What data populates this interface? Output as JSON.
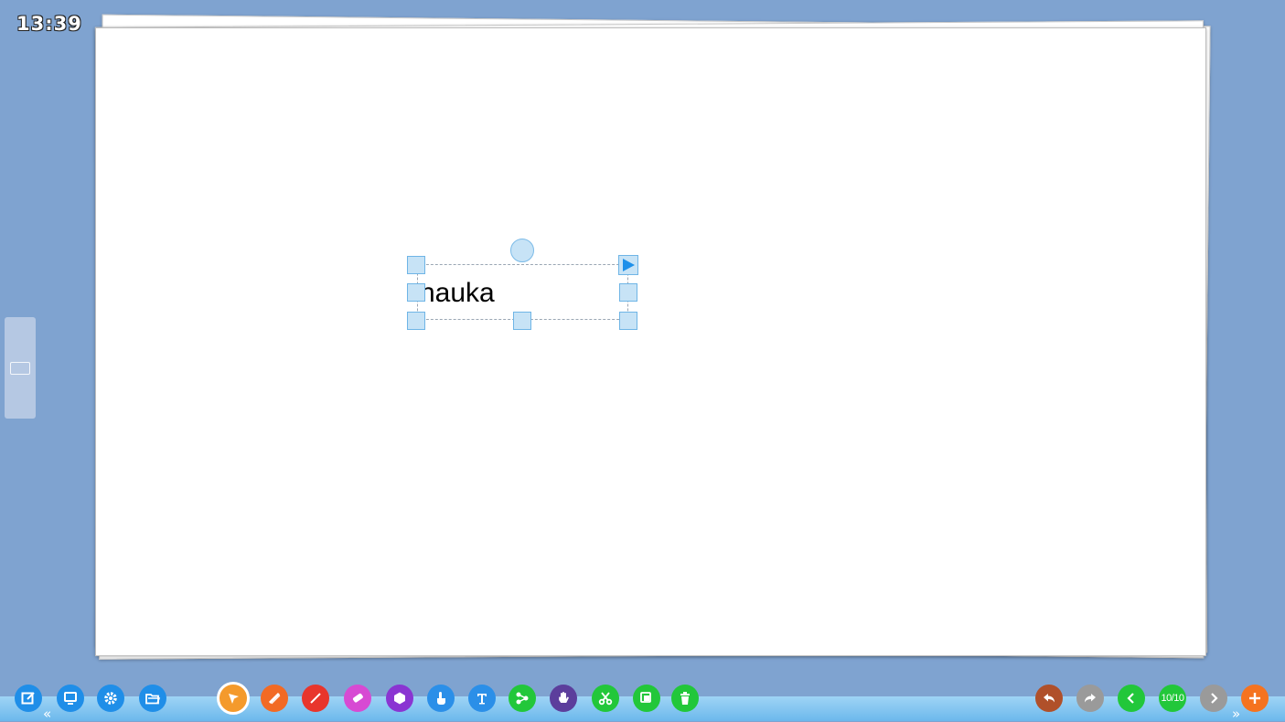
{
  "clock": {
    "time": "13:39"
  },
  "canvas": {
    "selected_object": {
      "text": "nauka"
    }
  },
  "colors": {
    "background": "#7fa3d0",
    "blue_button": "#1f8ee8",
    "select_tool": "#f49a2c",
    "pen_tool": "#f26a24",
    "line_tool": "#e8352c",
    "eraser_tool": "#d74ad3",
    "shape_tool": "#8a35d2",
    "touch_tool": "#2b8fe8",
    "text_tool": "#2b8fe8",
    "green_tools": "#22c73a",
    "hand_tool": "#5c3e9c",
    "undo": "#b0502a",
    "redo": "#9a9a9a",
    "next_page": "#9a9a9a",
    "add_page": "#f5731f"
  },
  "left_toolbar": [
    {
      "name": "edit-icon"
    },
    {
      "name": "screen-icon"
    },
    {
      "name": "gear-icon"
    },
    {
      "name": "folder-open-icon"
    }
  ],
  "main_toolbar": [
    {
      "name": "select-arrow-icon",
      "active": true
    },
    {
      "name": "pencil-icon"
    },
    {
      "name": "line-icon"
    },
    {
      "name": "eraser-icon"
    },
    {
      "name": "hexagon-icon"
    },
    {
      "name": "touch-finger-icon"
    },
    {
      "name": "text-icon"
    },
    {
      "name": "mindmap-icon"
    },
    {
      "name": "hand-icon"
    },
    {
      "name": "scissors-icon"
    },
    {
      "name": "copy-icon"
    },
    {
      "name": "trash-icon"
    }
  ],
  "right_toolbar": {
    "page_indicator": "10/10",
    "buttons": [
      "undo-icon",
      "redo-icon",
      "prev-page-icon",
      "next-page-icon",
      "add-page-icon"
    ]
  },
  "side_panel": {
    "icon": "panel-toggle-icon"
  }
}
